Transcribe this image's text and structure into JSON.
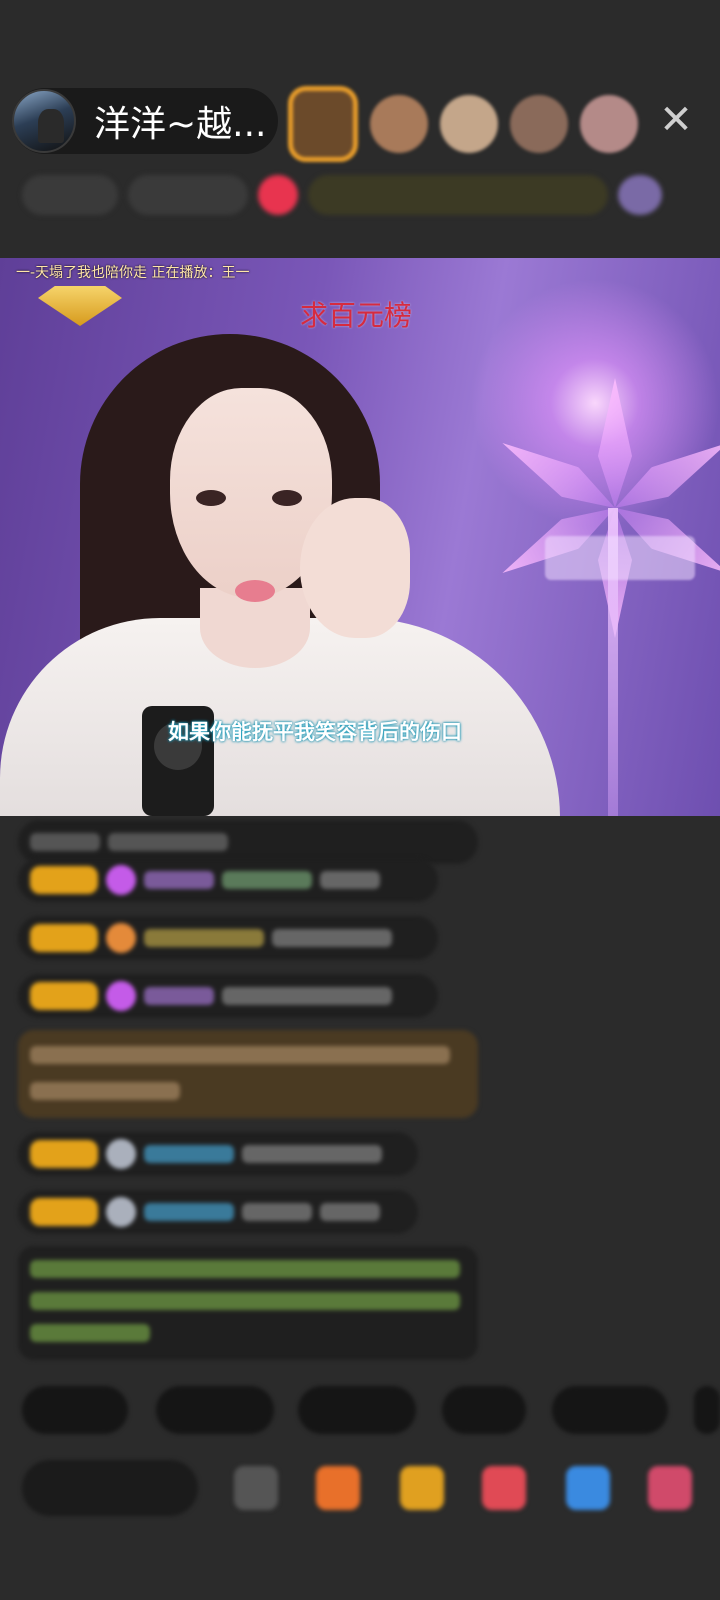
{
  "header": {
    "host_name": "洋洋~越...",
    "close_symbol": "✕",
    "viewer_colors": [
      "#6b4a2a",
      "#a87a5a",
      "#c4a68a",
      "#8a6a5a",
      "#b48a88"
    ]
  },
  "video": {
    "song_info": "一-天塌了我也陪你走  正在播放：王一",
    "request_text": "求百元榜",
    "lyrics": "如果你能抚平我笑容背后的伤口"
  },
  "colors": {
    "background": "#2b2b2b",
    "accent_gold": "#e3a21a",
    "chat_bubble": "#1f1f1f"
  }
}
